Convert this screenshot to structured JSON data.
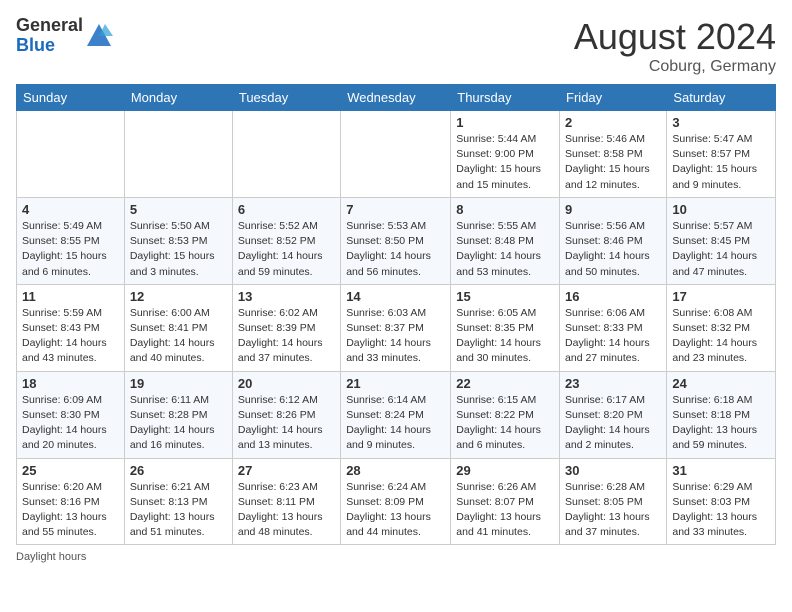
{
  "header": {
    "logo_line1": "General",
    "logo_line2": "Blue",
    "month": "August 2024",
    "location": "Coburg, Germany"
  },
  "days_of_week": [
    "Sunday",
    "Monday",
    "Tuesday",
    "Wednesday",
    "Thursday",
    "Friday",
    "Saturday"
  ],
  "weeks": [
    [
      {
        "day": "",
        "detail": ""
      },
      {
        "day": "",
        "detail": ""
      },
      {
        "day": "",
        "detail": ""
      },
      {
        "day": "",
        "detail": ""
      },
      {
        "day": "1",
        "detail": "Sunrise: 5:44 AM\nSunset: 9:00 PM\nDaylight: 15 hours and 15 minutes."
      },
      {
        "day": "2",
        "detail": "Sunrise: 5:46 AM\nSunset: 8:58 PM\nDaylight: 15 hours and 12 minutes."
      },
      {
        "day": "3",
        "detail": "Sunrise: 5:47 AM\nSunset: 8:57 PM\nDaylight: 15 hours and 9 minutes."
      }
    ],
    [
      {
        "day": "4",
        "detail": "Sunrise: 5:49 AM\nSunset: 8:55 PM\nDaylight: 15 hours and 6 minutes."
      },
      {
        "day": "5",
        "detail": "Sunrise: 5:50 AM\nSunset: 8:53 PM\nDaylight: 15 hours and 3 minutes."
      },
      {
        "day": "6",
        "detail": "Sunrise: 5:52 AM\nSunset: 8:52 PM\nDaylight: 14 hours and 59 minutes."
      },
      {
        "day": "7",
        "detail": "Sunrise: 5:53 AM\nSunset: 8:50 PM\nDaylight: 14 hours and 56 minutes."
      },
      {
        "day": "8",
        "detail": "Sunrise: 5:55 AM\nSunset: 8:48 PM\nDaylight: 14 hours and 53 minutes."
      },
      {
        "day": "9",
        "detail": "Sunrise: 5:56 AM\nSunset: 8:46 PM\nDaylight: 14 hours and 50 minutes."
      },
      {
        "day": "10",
        "detail": "Sunrise: 5:57 AM\nSunset: 8:45 PM\nDaylight: 14 hours and 47 minutes."
      }
    ],
    [
      {
        "day": "11",
        "detail": "Sunrise: 5:59 AM\nSunset: 8:43 PM\nDaylight: 14 hours and 43 minutes."
      },
      {
        "day": "12",
        "detail": "Sunrise: 6:00 AM\nSunset: 8:41 PM\nDaylight: 14 hours and 40 minutes."
      },
      {
        "day": "13",
        "detail": "Sunrise: 6:02 AM\nSunset: 8:39 PM\nDaylight: 14 hours and 37 minutes."
      },
      {
        "day": "14",
        "detail": "Sunrise: 6:03 AM\nSunset: 8:37 PM\nDaylight: 14 hours and 33 minutes."
      },
      {
        "day": "15",
        "detail": "Sunrise: 6:05 AM\nSunset: 8:35 PM\nDaylight: 14 hours and 30 minutes."
      },
      {
        "day": "16",
        "detail": "Sunrise: 6:06 AM\nSunset: 8:33 PM\nDaylight: 14 hours and 27 minutes."
      },
      {
        "day": "17",
        "detail": "Sunrise: 6:08 AM\nSunset: 8:32 PM\nDaylight: 14 hours and 23 minutes."
      }
    ],
    [
      {
        "day": "18",
        "detail": "Sunrise: 6:09 AM\nSunset: 8:30 PM\nDaylight: 14 hours and 20 minutes."
      },
      {
        "day": "19",
        "detail": "Sunrise: 6:11 AM\nSunset: 8:28 PM\nDaylight: 14 hours and 16 minutes."
      },
      {
        "day": "20",
        "detail": "Sunrise: 6:12 AM\nSunset: 8:26 PM\nDaylight: 14 hours and 13 minutes."
      },
      {
        "day": "21",
        "detail": "Sunrise: 6:14 AM\nSunset: 8:24 PM\nDaylight: 14 hours and 9 minutes."
      },
      {
        "day": "22",
        "detail": "Sunrise: 6:15 AM\nSunset: 8:22 PM\nDaylight: 14 hours and 6 minutes."
      },
      {
        "day": "23",
        "detail": "Sunrise: 6:17 AM\nSunset: 8:20 PM\nDaylight: 14 hours and 2 minutes."
      },
      {
        "day": "24",
        "detail": "Sunrise: 6:18 AM\nSunset: 8:18 PM\nDaylight: 13 hours and 59 minutes."
      }
    ],
    [
      {
        "day": "25",
        "detail": "Sunrise: 6:20 AM\nSunset: 8:16 PM\nDaylight: 13 hours and 55 minutes."
      },
      {
        "day": "26",
        "detail": "Sunrise: 6:21 AM\nSunset: 8:13 PM\nDaylight: 13 hours and 51 minutes."
      },
      {
        "day": "27",
        "detail": "Sunrise: 6:23 AM\nSunset: 8:11 PM\nDaylight: 13 hours and 48 minutes."
      },
      {
        "day": "28",
        "detail": "Sunrise: 6:24 AM\nSunset: 8:09 PM\nDaylight: 13 hours and 44 minutes."
      },
      {
        "day": "29",
        "detail": "Sunrise: 6:26 AM\nSunset: 8:07 PM\nDaylight: 13 hours and 41 minutes."
      },
      {
        "day": "30",
        "detail": "Sunrise: 6:28 AM\nSunset: 8:05 PM\nDaylight: 13 hours and 37 minutes."
      },
      {
        "day": "31",
        "detail": "Sunrise: 6:29 AM\nSunset: 8:03 PM\nDaylight: 13 hours and 33 minutes."
      }
    ]
  ],
  "footer": "Daylight hours"
}
